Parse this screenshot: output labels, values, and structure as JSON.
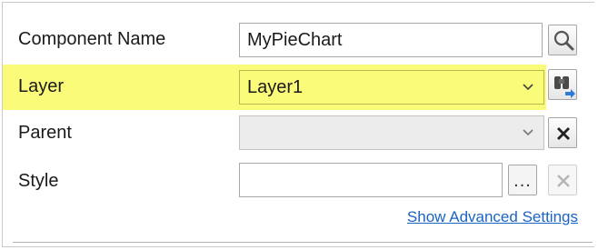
{
  "properties": {
    "component_name": {
      "label": "Component Name",
      "value": "MyPieChart",
      "button_icon": "magnifier-icon"
    },
    "layer": {
      "label": "Layer",
      "value": "Layer1",
      "button_icon": "binoculars-icon"
    },
    "parent": {
      "label": "Parent",
      "value": "",
      "button_icon": "close-x-icon"
    },
    "style": {
      "label": "Style",
      "value": "",
      "browse_label": "...",
      "button_icon": "close-x-icon"
    }
  },
  "advanced_link": "Show Advanced Settings",
  "colors": {
    "highlight": "#fbfb7a",
    "link": "#1a64c2"
  }
}
